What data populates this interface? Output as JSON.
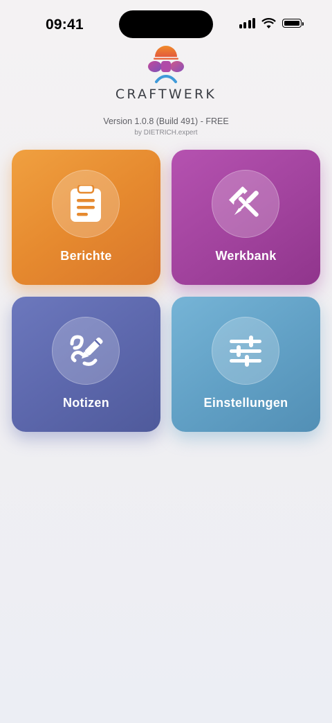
{
  "status_bar": {
    "time": "09:41",
    "battery_level": 1.0
  },
  "header": {
    "brand": "CRAFTWERK",
    "version": "Version 1.0.8 (Build 491) - FREE",
    "byline": "by DIETRICH.expert",
    "logo_icon": "craftwerk-logo-icon"
  },
  "tiles": [
    {
      "label": "Berichte",
      "icon": "clipboard-icon",
      "color": "#e68a2f"
    },
    {
      "label": "Werkbank",
      "icon": "tools-icon",
      "color": "#a3449f"
    },
    {
      "label": "Notizen",
      "icon": "pen-note-icon",
      "color": "#5d68ad"
    },
    {
      "label": "Einstellungen",
      "icon": "sliders-icon",
      "color": "#62a1c6"
    }
  ]
}
